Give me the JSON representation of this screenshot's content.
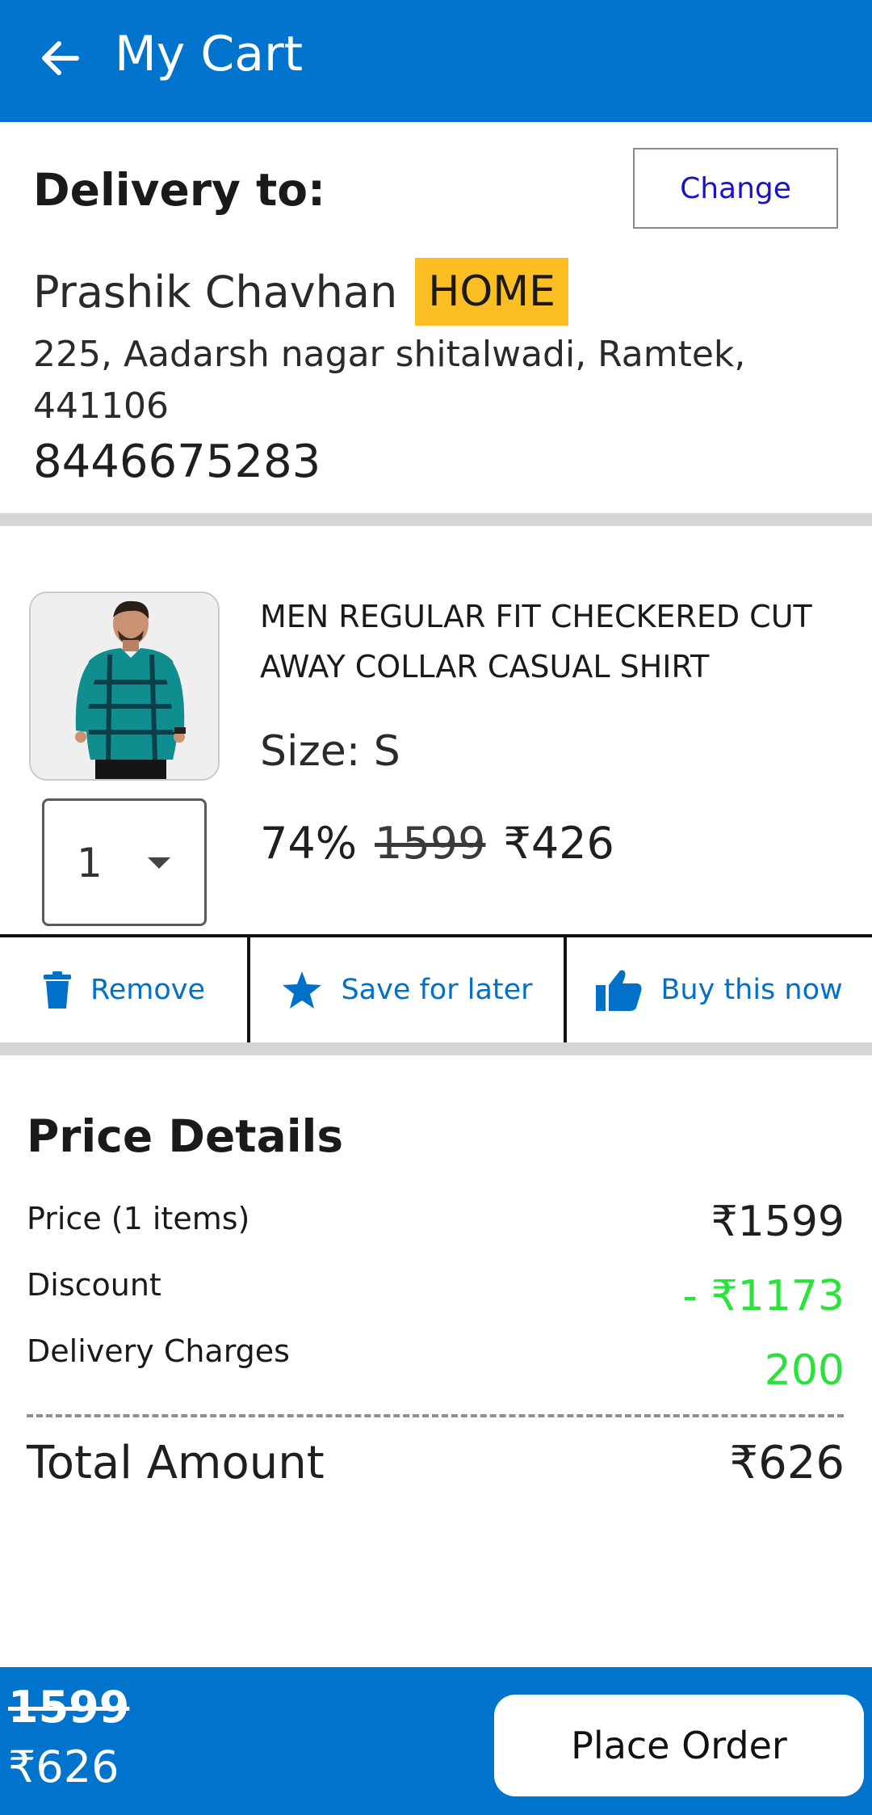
{
  "header": {
    "title": "My Cart",
    "back_icon": "arrow-left-icon"
  },
  "delivery": {
    "heading": "Delivery to:",
    "change_label": "Change",
    "name": "Prashik Chavhan",
    "tag": "HOME",
    "address": "225, Aadarsh nagar shitalwadi, Ramtek, 441106",
    "phone": "8446675283"
  },
  "product": {
    "title": "MEN REGULAR FIT CHECKERED CUT AWAY COLLAR CASUAL SHIRT",
    "size": "Size: S",
    "discount": "74%",
    "original_price": "1599",
    "price": "₹426",
    "quantity": "1"
  },
  "actions": {
    "remove": "Remove",
    "save_for_later": "Save for later",
    "buy_now": "Buy this now"
  },
  "price_details": {
    "title": "Price Details",
    "rows": [
      {
        "label": "Price (1 items)",
        "value": "₹1599"
      },
      {
        "label": "Discount",
        "value": "- ₹1173"
      },
      {
        "label": "Delivery Charges",
        "value": "200"
      }
    ],
    "total_label": "Total Amount",
    "total_value": "₹626"
  },
  "footer": {
    "old_price": "1599",
    "new_price": "₹626",
    "place_order": "Place Order"
  },
  "colors": {
    "primary": "#0074cd",
    "tag": "#fbbf24",
    "discount_green": "#29e23a",
    "change_text": "#1a12c8"
  }
}
